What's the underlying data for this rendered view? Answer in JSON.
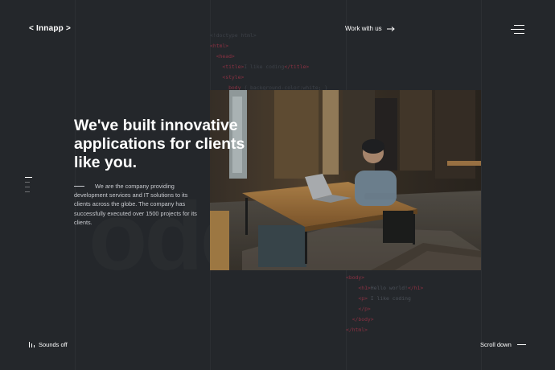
{
  "header": {
    "logo": "< Innapp >",
    "work_link": "Work with us"
  },
  "hero": {
    "headline": "We've built innovative applications for clients like you.",
    "intro": "We are the company providing development services and IT solutions to its clients across the globe. The company has successfully executed over 1500 projects for its clients."
  },
  "code_top": [
    {
      "parts": [
        {
          "t": "<!doctype html>",
          "k": "text"
        }
      ]
    },
    {
      "parts": [
        {
          "t": "<html>",
          "k": "tag"
        }
      ]
    },
    {
      "parts": [
        {
          "t": "  <head>",
          "k": "tag"
        }
      ]
    },
    {
      "parts": [
        {
          "t": "    <title>",
          "k": "tag"
        },
        {
          "t": "I like coding",
          "k": "text"
        },
        {
          "t": "</title>",
          "k": "tag"
        }
      ]
    },
    {
      "parts": [
        {
          "t": "    <style>",
          "k": "tag"
        }
      ]
    },
    {
      "parts": [
        {
          "t": "      body",
          "k": "tag"
        },
        {
          "t": " { background-color:white; }",
          "k": "text"
        }
      ]
    }
  ],
  "code_bottom": [
    {
      "parts": [
        {
          "t": "<body>",
          "k": "tag"
        }
      ]
    },
    {
      "parts": [
        {
          "t": "    <h1>",
          "k": "tag"
        },
        {
          "t": "Hello world!",
          "k": "text"
        },
        {
          "t": "</h1>",
          "k": "tag"
        }
      ]
    },
    {
      "parts": [
        {
          "t": "    <p>",
          "k": "tag"
        },
        {
          "t": " I like coding",
          "k": "text"
        }
      ]
    },
    {
      "parts": [
        {
          "t": "    </p>",
          "k": "tag"
        }
      ]
    },
    {
      "parts": [
        {
          "t": "  </body>",
          "k": "tag"
        }
      ]
    },
    {
      "parts": [
        {
          "t": "</html>",
          "k": "tag"
        }
      ]
    }
  ],
  "footer": {
    "sound_label": "Sounds off",
    "scroll_label": "Scroll down"
  },
  "pager": {
    "count": 4,
    "active": 0
  },
  "colors": {
    "background": "#24272b",
    "text": "#ffffff",
    "code_tag": "#8a3142",
    "code_text": "#4b5058"
  },
  "icons": [
    "arrow-right-icon",
    "menu-icon",
    "sound-bars-icon"
  ]
}
